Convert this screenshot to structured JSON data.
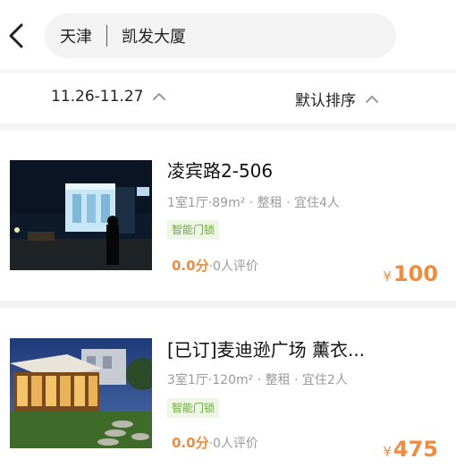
{
  "header": {
    "back_icon": "chevron-left-icon",
    "city": "天津",
    "keyword": "凯发大厦"
  },
  "filters": {
    "date_range": "11.26-11.27",
    "sort": "默认排序",
    "chevron_icon": "chevron-up-icon"
  },
  "listings": [
    {
      "title": "凌宾路2-506",
      "meta": "1室1厅·89m² · 整租 · 宜住4人",
      "tag": "智能门锁",
      "score": "0.0分",
      "reviews": "·0人评价",
      "currency": "¥",
      "price": "100"
    },
    {
      "title": "[已订]麦迪逊广场 薰衣...",
      "meta": "3室1厅·120m² · 整租 · 宜住2人",
      "tag": "智能门锁",
      "score": "0.0分",
      "reviews": "·0人评价",
      "currency": "¥",
      "price": "475"
    }
  ],
  "colors": {
    "accent": "#f08c3c",
    "tag_text": "#6aab3a",
    "tag_bg": "#eef7e6",
    "search_bg": "#f3f3f3",
    "muted_text": "#9a9a9a"
  }
}
